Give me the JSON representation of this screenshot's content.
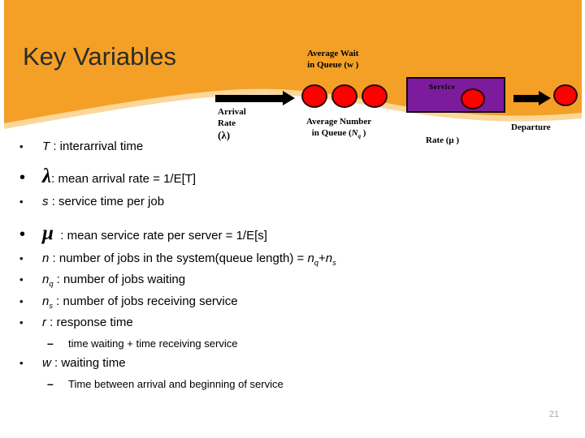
{
  "slide": {
    "title": "Key Variables",
    "page_number": "21",
    "colors": {
      "banner_orange": "#F4A026",
      "banner_fringe": "#FBD79B",
      "job_red": "#FE0000",
      "service_purple": "#7C1C9C",
      "text_black": "#000000",
      "page_number_gray": "#A8A8A8"
    }
  },
  "diagram": {
    "arrival_label_lines": [
      "Arrival",
      "Rate",
      "(λ)"
    ],
    "arrival_rate_line1": "Arrival",
    "arrival_rate_line2": "Rate",
    "arrival_rate_symbol": "(λ)",
    "average_wait_line1": "Average Wait",
    "average_wait_line2": "in Queue (w )",
    "average_number_line1": "Average Number",
    "average_number_line2": "in Queue (Nq )",
    "service_box_label": "Service",
    "service_rate_label": "Rate (μ )",
    "departure_label": "Departure",
    "queue_circle_count": 3
  },
  "bullets": [
    {
      "level": 1,
      "marker": "•",
      "symbol": "T",
      "text": " : interarrival time"
    },
    {
      "level": 1,
      "marker": "•",
      "symbol": "λ",
      "text": " : mean arrival rate = 1/E[T]"
    },
    {
      "level": 1,
      "marker": "•",
      "symbol": "s",
      "text": " : service time per job"
    },
    {
      "level": 1,
      "marker": "•",
      "symbol": "μ",
      "text": " : mean service rate per server = 1/E[s]"
    },
    {
      "level": 1,
      "marker": "•",
      "symbol": "n",
      "text": " : number of jobs in the system(queue length) = nq+ns"
    },
    {
      "level": 1,
      "marker": "•",
      "symbol": "nq",
      "text": " : number of jobs waiting"
    },
    {
      "level": 1,
      "marker": "•",
      "symbol": "ns",
      "text": " : number of jobs receiving service"
    },
    {
      "level": 1,
      "marker": "•",
      "symbol": "r",
      "text": " : response time"
    },
    {
      "level": 2,
      "marker": "–",
      "symbol": "",
      "text": "time waiting + time receiving service"
    },
    {
      "level": 1,
      "marker": "•",
      "symbol": "w",
      "text": " : waiting time"
    },
    {
      "level": 2,
      "marker": "–",
      "symbol": "",
      "text": "Time between arrival and beginning of service"
    }
  ],
  "bullet_lines": {
    "l1_symbol": "T",
    "l1_rest": ": interarrival time",
    "l2_symbol": "λ",
    "l2_rest": ": mean arrival rate = 1/E[T]",
    "l3_symbol": "s",
    "l3_rest": ": service time per job",
    "l4_symbol": "μ",
    "l4_rest": ": mean service rate per server = 1/E[s]",
    "l5_symbol": "n",
    "l5_rest_a": ": number of jobs in the system(queue length) = ",
    "l5_n1": "n",
    "l5_sub1": "q",
    "l5_plus": "+",
    "l5_n2": "n",
    "l5_sub2": "s",
    "l6_symbol": "n",
    "l6_sub": "q",
    "l6_rest": " : number of jobs waiting",
    "l7_symbol": "n",
    "l7_sub": "s",
    "l7_rest": " : number of jobs receiving service",
    "l8_symbol": "r",
    "l8_rest": ": response time",
    "l9_dash": "–",
    "l9_rest": "time waiting + time receiving service",
    "l10_symbol": "w",
    "l10_rest": ": waiting time",
    "l11_dash": "–",
    "l11_rest": "Time between arrival and beginning of service",
    "marker": "•"
  }
}
